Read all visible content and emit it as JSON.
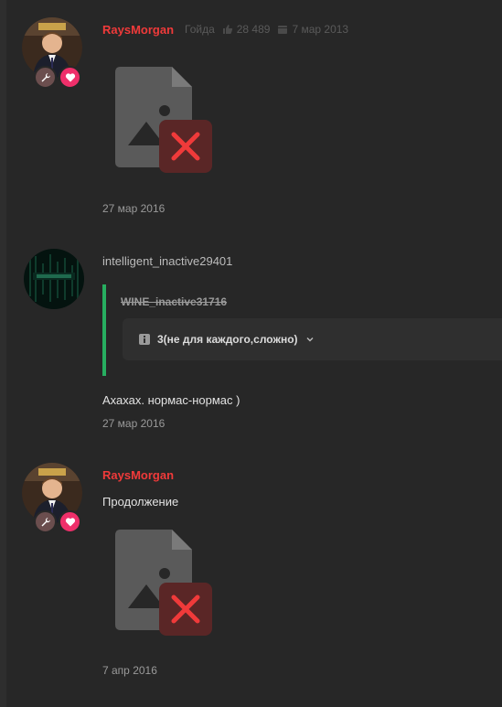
{
  "posts": [
    {
      "username": "RaysMorgan",
      "group": "Гойда",
      "likes": "28 489",
      "registered": "7 мар 2013",
      "date": "27 мар 2016"
    },
    {
      "username": "intelligent_inactive29401",
      "quote_author": "WINE_inactive31716",
      "spoiler_label": "3(не для каждого,сложно)",
      "text": "Ахахах. нормас-нормас )",
      "date": "27 мар 2016"
    },
    {
      "username": "RaysMorgan",
      "text": "Продолжение",
      "date": "7 апр 2016"
    }
  ],
  "icons": {
    "broken_image": "broken-image-icon",
    "wrench": "wrench-icon",
    "heart": "heart-icon",
    "like": "thumbs-up-icon",
    "calendar": "calendar-icon",
    "info": "info-icon",
    "chevron": "chevron-down-icon"
  },
  "colors": {
    "background": "#272727",
    "username_accent": "#f03a3a",
    "quote_bar": "#27ae60",
    "heart_badge": "#ef2f6a"
  }
}
